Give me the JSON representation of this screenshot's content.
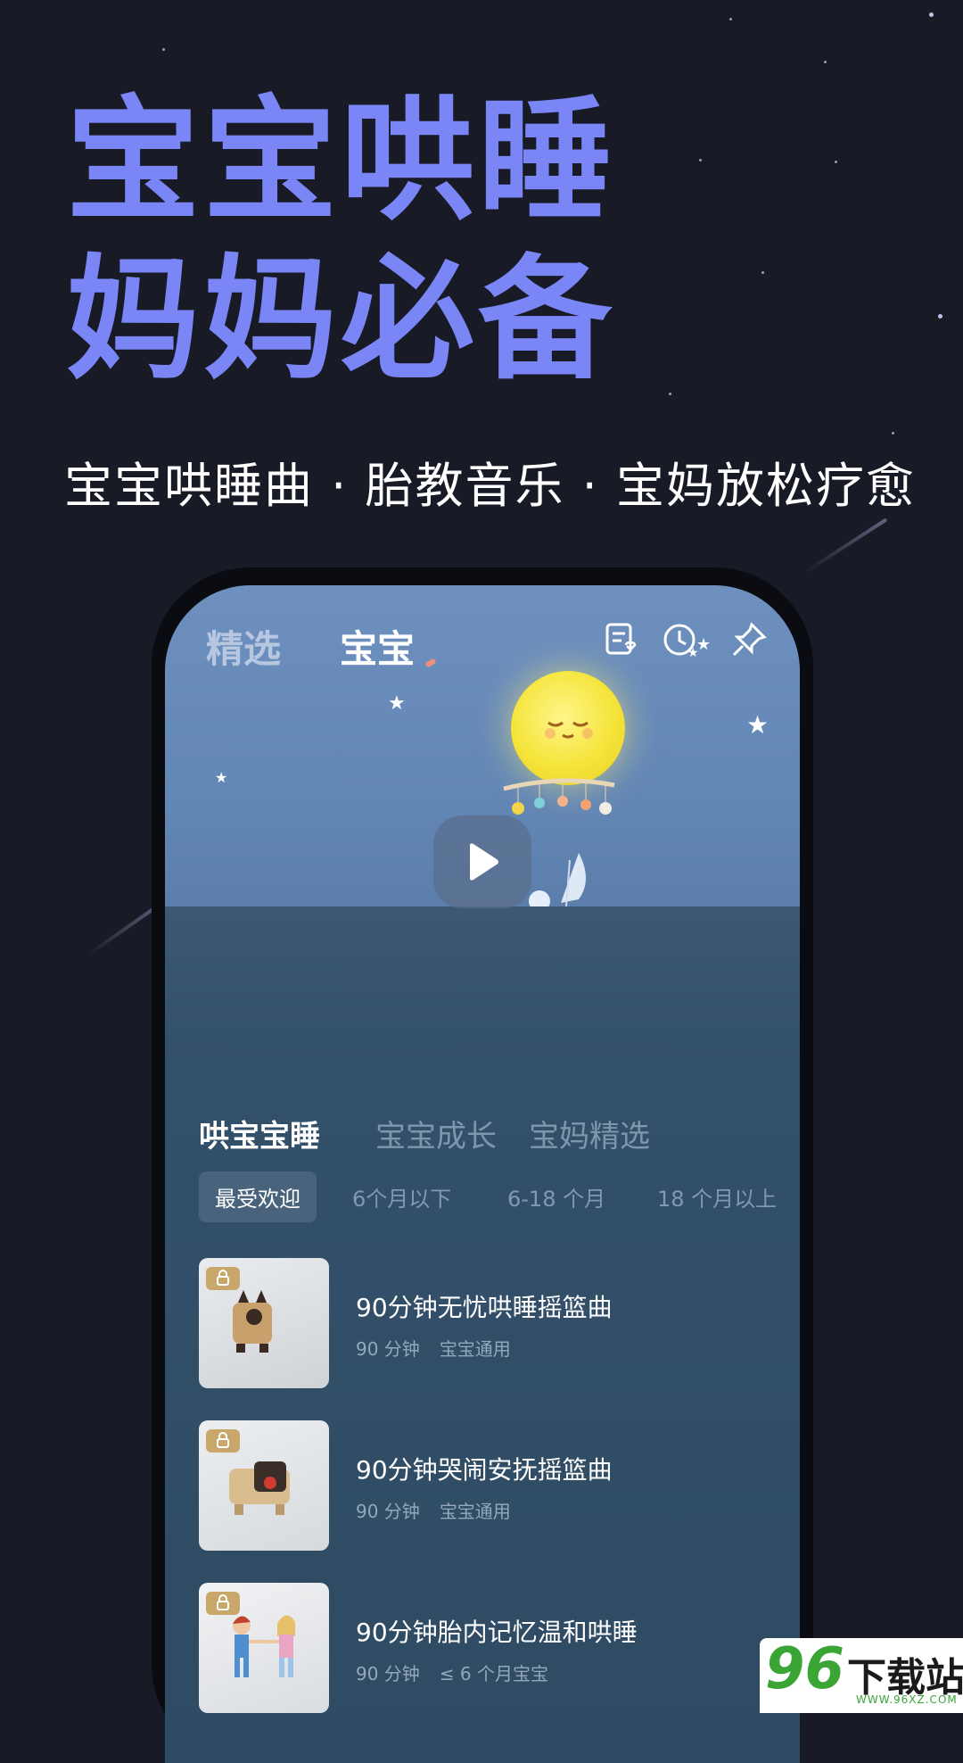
{
  "headline": {
    "line1": "宝宝哄睡",
    "line2": "妈妈必备",
    "subtitle": "宝宝哄睡曲 · 胎教音乐 · 宝妈放松疗愈",
    "color": "#7a86f5"
  },
  "app": {
    "top_tabs": [
      {
        "label": "精选",
        "active": false
      },
      {
        "label": "宝宝",
        "active": true
      }
    ],
    "top_icons": [
      "playlist-heart-icon",
      "timer-clock-icon",
      "pin-icon"
    ],
    "player": {
      "play_icon": "play-icon"
    },
    "category_tabs": [
      {
        "label": "哄宝宝睡",
        "active": true
      },
      {
        "label": "宝宝成长",
        "active": false
      },
      {
        "label": "宝妈精选",
        "active": false
      }
    ],
    "age_filters": [
      {
        "label": "最受欢迎",
        "selected": true
      },
      {
        "label": "6个月以下",
        "selected": false
      },
      {
        "label": "6-18 个月",
        "selected": false
      },
      {
        "label": "18 个月以上",
        "selected": false
      }
    ],
    "tracks": [
      {
        "title": "90分钟无忧哄睡摇篮曲",
        "duration": "90 分钟",
        "audience": "宝宝通用",
        "locked": true,
        "thumb": "toy-cat-figure"
      },
      {
        "title": "90分钟哭闹安抚摇篮曲",
        "duration": "90 分钟",
        "audience": "宝宝通用",
        "locked": true,
        "thumb": "toy-pug-figure"
      },
      {
        "title": "90分钟胎内记忆温和哄睡",
        "duration": "90 分钟",
        "audience": "≤ 6 个月宝宝",
        "locked": true,
        "thumb": "toy-kids-holding-hands"
      }
    ]
  },
  "watermark": {
    "number": "96",
    "text": "下载站",
    "url": "WWW.96XZ.COM"
  }
}
